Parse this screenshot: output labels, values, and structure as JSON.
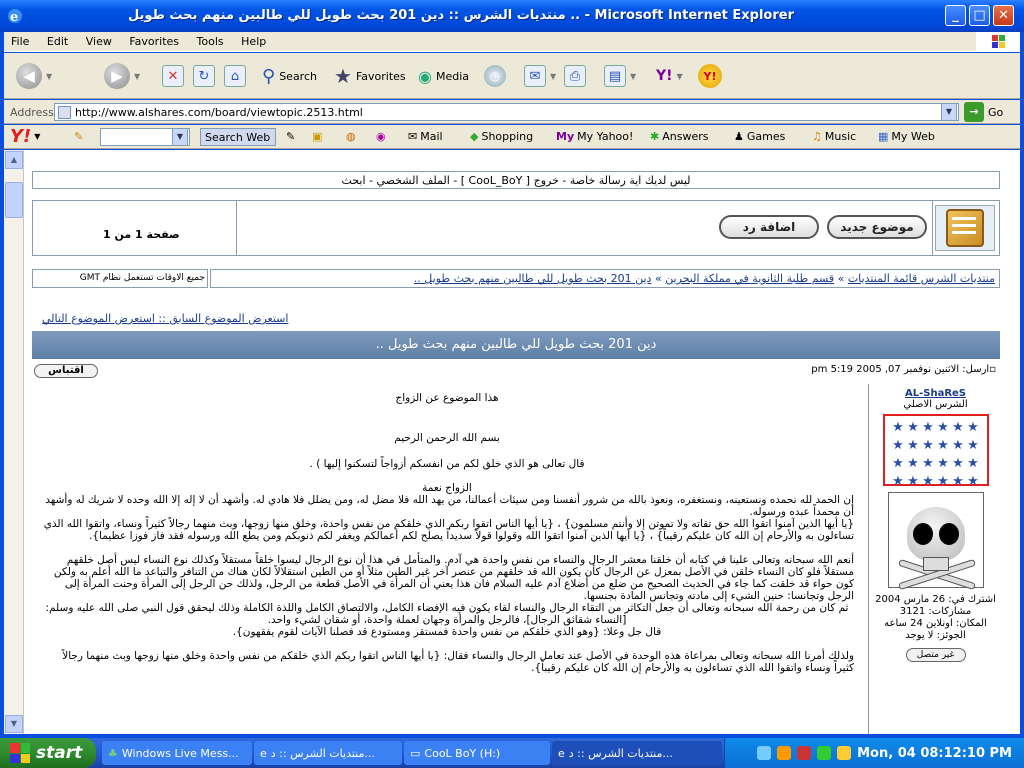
{
  "window": {
    "title": "منتديات الشرس :: دين 201 بحث طويل للي طالبين منهم بحث طويل .. - Microsoft Internet Explorer"
  },
  "menu": [
    "File",
    "Edit",
    "View",
    "Favorites",
    "Tools",
    "Help"
  ],
  "toolbar": {
    "search": "Search",
    "favorites": "Favorites",
    "media": "Media"
  },
  "address": {
    "label": "Address",
    "url": "http://www.alshares.com/board/viewtopic.2513.html",
    "go": "Go"
  },
  "yahoo": {
    "search_web": "Search Web",
    "items": [
      "Mail",
      "Shopping",
      "My Yahoo!",
      "Answers",
      "Games",
      "Music",
      "My Web"
    ]
  },
  "forum": {
    "user_nav": "ليس لديك اية رسالة خاصة - خروج [ CooL_BoY ] - الملف الشخصي - ابحث",
    "new_topic": "موضوع جديد",
    "reply": "اضافة رد",
    "page_no": "صفحة 1 من 1",
    "breadcrumb_home": "منتديات الشرس قائمة المنتديات",
    "breadcrumb_forum": "قسم طلبة الثانوية في مملكة البحرين",
    "breadcrumb_topic": "دين 201 بحث طويل للي طالبين منهم بحث طويل ..",
    "sep": "»",
    "gmt": "جميع الاوقات تستعمل نظام GMT",
    "prev": "استعرض الموضوع السابق",
    "prevnext_sep": "::",
    "next": "استعرض الموضوع التالي",
    "topic_title": "دين 201 بحث طويل للي طالبين منهم بحث طويل ..",
    "post_date": "ارسل: الاثنين نوفمبر 07, 2005 5:19 pm",
    "quote": "اقتباس",
    "author": {
      "name": "AL-ShaReS",
      "rank": "الشرس الاصلي",
      "joined": "اشترك في: 26 مارس 2004",
      "posts": "مشاركات: 3121",
      "location": "المكان: اونلاين 24 ساعه",
      "gender": "الجوئز: لا يوجد",
      "offline": "غير متصل"
    },
    "body": [
      "هذا الموضوع عن الزواج",
      "بسم الله الرحمن الرحيم",
      "قال تعالى هو الذي خلق لكم من انفسكم أزواجاً لتسكنوا إليها ) .",
      "الزواج نعمة",
      "إن الحمد لله نحمده ونستعينه، ونستغفره، ونعوذ بالله من شرور أنفسنا ومن سيئات أعمالنا، من يهد الله فلا مضل له، ومن يضلل فلا هادي له. وأشهد أن لا إله إلا الله وحده لا شريك له وأشهد أن محمداً عبده ورسوله.",
      "{يا أيها الذين آمنوا اتقوا الله حق تقاته ولا تموتن إلا وأنتم مسلمون} ، {يا أيها الناس اتقوا ربكم الذي خلقكم من نفس واحدة، وخلق منها زوجها، وبث منهما رجالاً كثيراً ونساء، واتقوا الله الذي تساءلون به والأرحام إن الله كان عليكم رقيباً} ، {يا أيها الذين آمنوا اتقوا الله وقولوا قولاً سديداً يصلح لكم أعمالكم ويغفر لكم ذنوبكم ومن يطع الله ورسوله فقد فاز فوزا عظيما}.",
      "أنعم الله سبحانه وتعالى علينا في كتابه أن خلقنا معشر الرجال والنساء من نفس واحدة هي آدم. والمتأمل في هذا أن نوع الرجال ليسوا خلقاً مستقلاً وكذلك نوع النساء ليس أصل خلقهم مستقلاً فلو كان النساء خلقن في الأصل بمعزل عن الرجال كأن يكون الله قد خلقهم من عنصر آخر غير الطين مثلاً أو من الطين استقلالاً لكان هناك من التنافر والتباعد ما الله أعلم به ولكن كون حواء قد خلقت كما جاء في الحديث الصحيح من ضلع من أضلاع آدم عليه السلام فان هذا يعني أن المرأة في الأصل قطعة من الرجل، ولذلك حن الرجل إلى المرأة وحنت المرأة إلى الرجل وتجانسا: حنين الشيء إلى مادته وتجانس المادة بجنسها.",
      "ثم كان من رحمة الله سبحانه وتعالى أن جعل التكاثر من التقاء الرجال والنساء لقاء يكون فيه الإفضاء الكامل، والالتصاق الكامل واللذة الكاملة وذلك ليحقق قول النبي صلى الله عليه وسلم: [النساء شقائق الرجال]، فالرجل والمرأة وجهان لعملة واحدة، أو شقان لشيء واحد.",
      "قال جل وعلا: {وهو الذي خلقكم من نفس واحدة فمستقر ومستودع قد فصلنا الآيات لقوم يفقهون}.",
      "ولذلك أمرنا الله سبحانه وتعالى بمراعاة هذه الوحدة في الأصل عند تعامل الرجال والنساء فقال: {يا أيها الناس اتقوا ربكم الذي خلقكم من نفس واحدة وخلق منها زوجها وبث منهما رجالاً كثيراً ونساء واتقوا الله الذي تساءلون به والأرحام إن الله كان عليكم رقيباً}."
    ]
  },
  "taskbar": {
    "start": "start",
    "tasks": [
      "Windows Live Mess...",
      "منتديات الشرس :: د...",
      "CooL BoY (H:)",
      "منتديات الشرس :: د..."
    ],
    "clock": "Mon, 04 08:12:10 PM"
  },
  "colors": {
    "title": "#0055e5",
    "taskbar": "#245edb",
    "start": "#2e8b2e",
    "stars": "#2a4fa8",
    "highlight": "#e02020"
  }
}
